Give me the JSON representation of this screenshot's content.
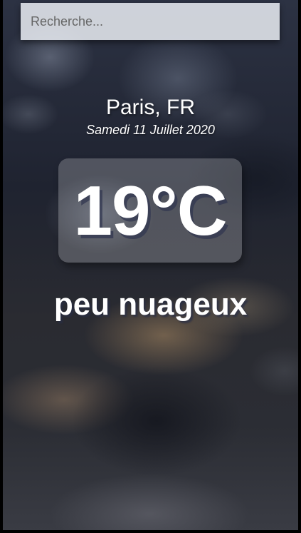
{
  "search": {
    "placeholder": "Recherche...",
    "value": ""
  },
  "location": {
    "city": "Paris, FR",
    "date": "Samedi 11 Juillet 2020"
  },
  "weather": {
    "temperature": "19°C",
    "description": "peu nuageux"
  },
  "colors": {
    "text": "#ffffff",
    "search_background": "#ebeef4"
  }
}
